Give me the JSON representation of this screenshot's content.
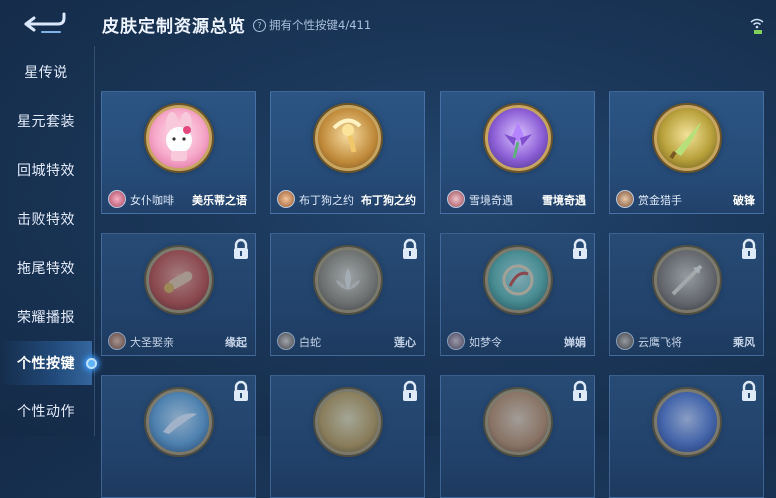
{
  "header": {
    "title": "皮肤定制资源总览",
    "owned_label": "拥有个性按键4/411",
    "help_symbol": "?"
  },
  "sidebar": {
    "items": [
      {
        "label": "星传说",
        "active": false
      },
      {
        "label": "星元套装",
        "active": false
      },
      {
        "label": "回城特效",
        "active": false
      },
      {
        "label": "击败特效",
        "active": false
      },
      {
        "label": "拖尾特效",
        "active": false
      },
      {
        "label": "荣耀播报",
        "active": false
      },
      {
        "label": "个性按键",
        "active": true
      },
      {
        "label": "个性动作",
        "active": false
      }
    ]
  },
  "grid": {
    "cards": [
      {
        "hero": "女仆咖啡",
        "skin": "美乐蒂之语",
        "locked": false,
        "emblem": "pink-bunny-doll-icon",
        "color": "#f6a8c8"
      },
      {
        "hero": "布丁狗之约",
        "skin": "布丁狗之约",
        "locked": false,
        "emblem": "golden-wand-icon",
        "color": "#d8a54a"
      },
      {
        "hero": "雪境奇遇",
        "skin": "雪境奇遇",
        "locked": false,
        "emblem": "purple-flower-icon",
        "color": "#9a6be0"
      },
      {
        "hero": "赏金猎手",
        "skin": "破锋",
        "locked": false,
        "emblem": "jade-blade-icon",
        "color": "#a7c65a"
      },
      {
        "hero": "大圣娶亲",
        "skin": "缘起",
        "locked": true,
        "emblem": "red-scroll-icon",
        "color": "#c94a3a"
      },
      {
        "hero": "白蛇",
        "skin": "莲心",
        "locked": true,
        "emblem": "lotus-icon",
        "color": "#b49a7a"
      },
      {
        "hero": "如梦令",
        "skin": "婵娟",
        "locked": true,
        "emblem": "moon-fan-icon",
        "color": "#5fb8a8"
      },
      {
        "hero": "云鹰飞将",
        "skin": "乘风",
        "locked": true,
        "emblem": "spear-icon",
        "color": "#8a7a6a"
      },
      {
        "hero": "",
        "skin": "",
        "locked": true,
        "emblem": "feather-icon",
        "color": "#6aa8d8"
      },
      {
        "hero": "",
        "skin": "",
        "locked": true,
        "emblem": "golden-emblem-icon",
        "color": "#c8a050"
      },
      {
        "hero": "",
        "skin": "",
        "locked": true,
        "emblem": "beast-emblem-icon",
        "color": "#c89060"
      },
      {
        "hero": "",
        "skin": "",
        "locked": true,
        "emblem": "blue-swirl-icon",
        "color": "#5a7ad0"
      }
    ]
  },
  "colors": {
    "background": "#1a3658",
    "card": "#2c5584",
    "accent": "#5fb4ff",
    "frame_gold": "#c7a560"
  }
}
